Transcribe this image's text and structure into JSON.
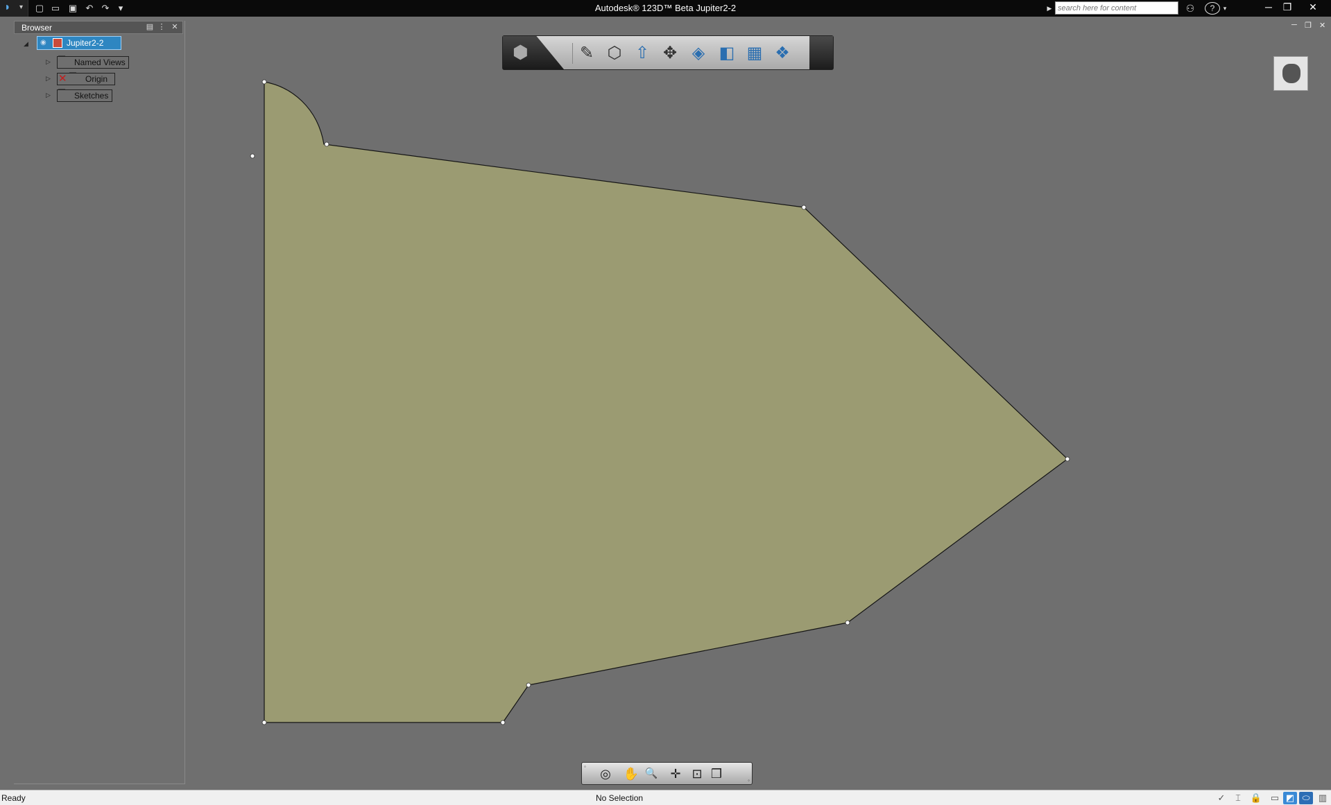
{
  "titlebar": {
    "app_menu_icon": "app-logo-icon",
    "title": "Autodesk® 123D™ Beta   Jupiter2-2",
    "search_placeholder": "search here for content",
    "quick_access": [
      {
        "name": "new-icon",
        "glyph": "▢"
      },
      {
        "name": "open-icon",
        "glyph": "▭"
      },
      {
        "name": "save-icon",
        "glyph": "▣"
      },
      {
        "name": "undo-icon",
        "glyph": "↶"
      },
      {
        "name": "redo-icon",
        "glyph": "↷"
      },
      {
        "name": "customize-icon",
        "glyph": "▾"
      }
    ],
    "help_glyph": "?",
    "binoculars_glyph": "⚇",
    "window_controls": {
      "minimize": "─",
      "restore": "❐",
      "close": "✕"
    }
  },
  "browser": {
    "title": "Browser",
    "root_label": "Jupiter2-2",
    "items": [
      {
        "label": "Named Views"
      },
      {
        "label": "Origin"
      },
      {
        "label": "Sketches"
      }
    ]
  },
  "view_toolbar": {
    "buttons": [
      {
        "name": "sketch-icon",
        "glyph": "✎"
      },
      {
        "name": "box-icon",
        "glyph": "⬡"
      },
      {
        "name": "extrude-icon",
        "glyph": "⇧"
      },
      {
        "name": "move-icon",
        "glyph": "✥"
      },
      {
        "name": "modify-icon",
        "glyph": "◈"
      },
      {
        "name": "combine-icon",
        "glyph": "◧"
      },
      {
        "name": "pattern-icon",
        "glyph": "▦"
      },
      {
        "name": "materials-icon",
        "glyph": "❖"
      }
    ]
  },
  "navbar": {
    "buttons": [
      {
        "name": "orbit-icon",
        "glyph": "◎"
      },
      {
        "name": "pan-icon",
        "glyph": "✋"
      },
      {
        "name": "zoom-icon",
        "glyph": "🔍"
      },
      {
        "name": "look-at-icon",
        "glyph": "✛"
      },
      {
        "name": "fit-icon",
        "glyph": "⊡"
      },
      {
        "name": "view-icon",
        "glyph": "❒"
      }
    ]
  },
  "status": {
    "left": "Ready",
    "middle": "No Selection"
  },
  "colors": {
    "background": "#6f6f6f",
    "sketch_fill": "#9b9b72",
    "selection_blue": "#2e86c1"
  }
}
